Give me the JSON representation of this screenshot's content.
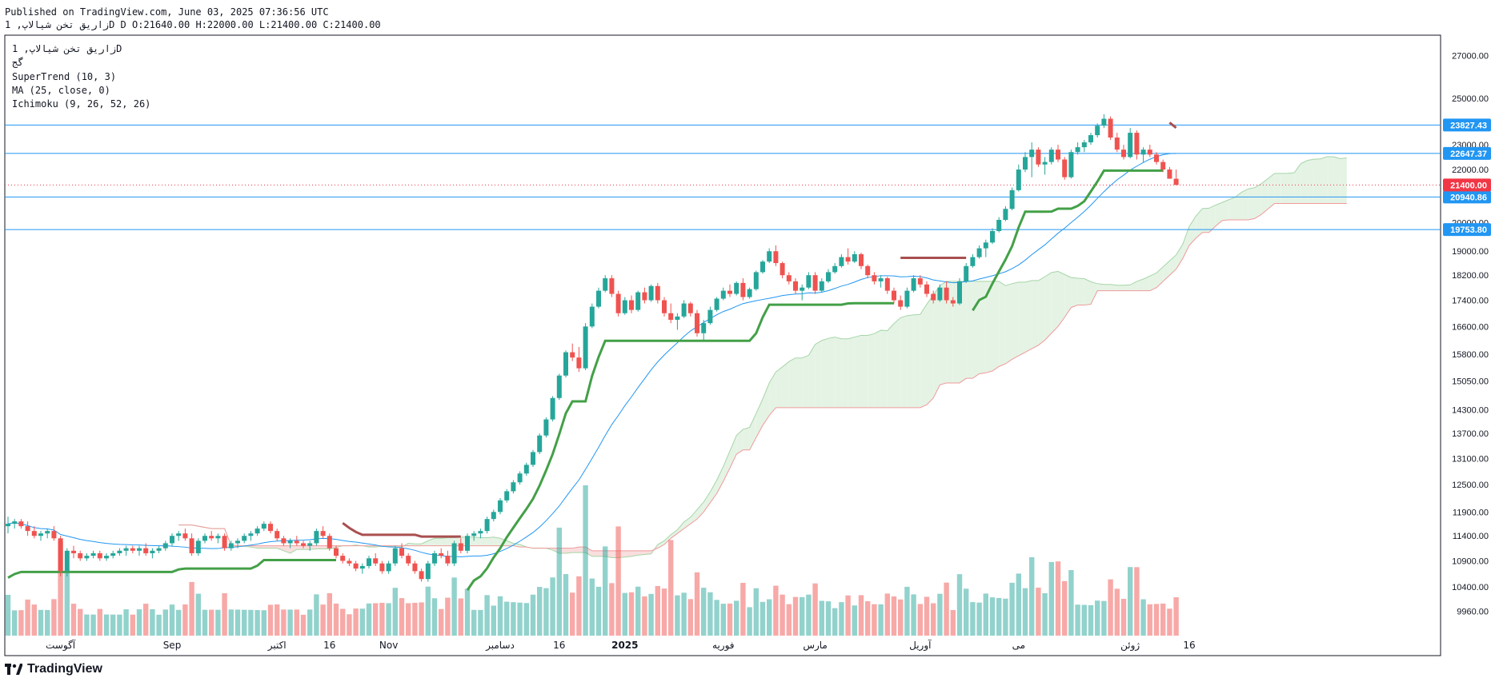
{
  "header": {
    "line1": "Published on TradingView.com, June 03, 2025 07:36:56 UTC",
    "symbol": "زاریق تخن شیالاپ, 1D",
    "ohlc": "D O:21640.00 H:22000.00 L:21400.00 C:21400.00"
  },
  "legend": {
    "title": "زاریق تخن شیالاپ, 1D",
    "line2": "گج",
    "supertrend": "SuperTrend (10, 3)",
    "ma": "MA (25, close, 0)",
    "ichimoku": "Ichimoku (9, 26, 52, 26)"
  },
  "brand": {
    "name": "TradingView"
  },
  "colors": {
    "up": "#26a69a",
    "down": "#ef5350",
    "supertrend_up": "#43a047",
    "supertrend_down": "#a94f4f",
    "ma": "#2196f3",
    "hline": "#2196f3",
    "cloud_green": "#e5f3e5",
    "cloud_red": "#f9dede",
    "price": "#f23645"
  },
  "chart_data": {
    "type": "candlestick",
    "interval": "1D",
    "y_axis": {
      "ticks": [
        27000,
        25000,
        23000,
        22000,
        20000,
        19000,
        18200,
        17400,
        16600,
        15800,
        15050,
        14300,
        13700,
        13100,
        12500,
        11900,
        11400,
        10900,
        10400,
        9960
      ],
      "tick_labels": [
        "27000.00",
        "25000.00",
        "23000.00",
        "22000.00",
        "20000.00",
        "19000.00",
        "18200.00",
        "17400.00",
        "16600.00",
        "15800.00",
        "15050.00",
        "14300.00",
        "13700.00",
        "13100.00",
        "12500.00",
        "11900.00",
        "11400.00",
        "10900.00",
        "10400.00",
        "9960.00"
      ],
      "scale": "log"
    },
    "x_axis": {
      "tick_labels": [
        "آگوست",
        "Sep",
        "اکتبر",
        "16",
        "Nov",
        "دسامبر",
        "16",
        "2025",
        "فوریه",
        "مارس",
        "آوریل",
        "می",
        "ژوئن",
        "16"
      ],
      "tick_bars": [
        8,
        25,
        41,
        49,
        58,
        75,
        84,
        94,
        109,
        123,
        139,
        154,
        171,
        180
      ]
    },
    "horizontal_lines": [
      {
        "value": 23827.43,
        "label": "23827.43"
      },
      {
        "value": 22647.37,
        "label": "22647.37"
      },
      {
        "value": 20940.86,
        "label": "20940.86"
      },
      {
        "value": 19753.8,
        "label": "19753.80"
      }
    ],
    "last_price": {
      "value": 21400.0,
      "label": "21400.00"
    },
    "ohlc": [
      [
        11600,
        11800,
        11450,
        11650
      ],
      [
        11650,
        11750,
        11550,
        11700
      ],
      [
        11700,
        11750,
        11550,
        11600
      ],
      [
        11600,
        11700,
        11400,
        11500
      ],
      [
        11500,
        11600,
        11350,
        11400
      ],
      [
        11400,
        11500,
        11300,
        11450
      ],
      [
        11450,
        11550,
        11350,
        11500
      ],
      [
        11500,
        11600,
        11300,
        11350
      ],
      [
        11350,
        11400,
        10600,
        10700
      ],
      [
        10700,
        11150,
        10600,
        11100
      ],
      [
        11100,
        11200,
        10950,
        11050
      ],
      [
        11050,
        11100,
        10900,
        10950
      ],
      [
        10950,
        11050,
        10900,
        11000
      ],
      [
        11000,
        11100,
        10950,
        11050
      ],
      [
        11050,
        11100,
        10900,
        10950
      ],
      [
        10950,
        11050,
        10900,
        11000
      ],
      [
        11000,
        11100,
        10950,
        11050
      ],
      [
        11050,
        11150,
        11000,
        11100
      ],
      [
        11100,
        11200,
        11000,
        11150
      ],
      [
        11150,
        11200,
        11050,
        11100
      ],
      [
        11100,
        11200,
        11000,
        11150
      ],
      [
        11150,
        11250,
        11000,
        11050
      ],
      [
        11050,
        11150,
        10950,
        11100
      ],
      [
        11100,
        11200,
        11050,
        11150
      ],
      [
        11150,
        11300,
        11100,
        11250
      ],
      [
        11250,
        11450,
        11200,
        11400
      ],
      [
        11400,
        11500,
        11300,
        11450
      ],
      [
        11450,
        11550,
        11300,
        11350
      ],
      [
        11350,
        11450,
        11000,
        11050
      ],
      [
        11050,
        11350,
        11000,
        11300
      ],
      [
        11300,
        11450,
        11250,
        11400
      ],
      [
        11400,
        11500,
        11300,
        11350
      ],
      [
        11350,
        11450,
        11250,
        11400
      ],
      [
        11400,
        11450,
        11100,
        11150
      ],
      [
        11150,
        11300,
        11100,
        11250
      ],
      [
        11250,
        11350,
        11150,
        11300
      ],
      [
        11300,
        11450,
        11250,
        11400
      ],
      [
        11400,
        11500,
        11300,
        11450
      ],
      [
        11450,
        11600,
        11400,
        11550
      ],
      [
        11550,
        11700,
        11500,
        11650
      ],
      [
        11650,
        11700,
        11450,
        11500
      ],
      [
        11500,
        11550,
        11300,
        11350
      ],
      [
        11350,
        11400,
        11200,
        11250
      ],
      [
        11250,
        11350,
        11150,
        11300
      ],
      [
        11300,
        11400,
        11200,
        11250
      ],
      [
        11250,
        11300,
        11150,
        11200
      ],
      [
        11200,
        11300,
        11100,
        11250
      ],
      [
        11250,
        11550,
        11200,
        11500
      ],
      [
        11500,
        11600,
        11350,
        11400
      ],
      [
        11400,
        11450,
        11100,
        11150
      ],
      [
        11150,
        11200,
        10950,
        11000
      ],
      [
        11000,
        11050,
        10850,
        10900
      ],
      [
        10900,
        10950,
        10800,
        10850
      ],
      [
        10850,
        10900,
        10700,
        10750
      ],
      [
        10750,
        10850,
        10650,
        10800
      ],
      [
        10800,
        11000,
        10750,
        10950
      ],
      [
        10950,
        11050,
        10800,
        10850
      ],
      [
        10850,
        10900,
        10650,
        10700
      ],
      [
        10700,
        10900,
        10650,
        10850
      ],
      [
        10850,
        11200,
        10800,
        11150
      ],
      [
        11150,
        11250,
        10950,
        11000
      ],
      [
        11000,
        11050,
        10800,
        10850
      ],
      [
        10850,
        10900,
        10650,
        10700
      ],
      [
        10700,
        10750,
        10500,
        10550
      ],
      [
        10550,
        10900,
        10500,
        10850
      ],
      [
        10850,
        11100,
        10800,
        11050
      ],
      [
        11050,
        11150,
        10950,
        11000
      ],
      [
        11000,
        11100,
        10800,
        10850
      ],
      [
        10850,
        11300,
        10800,
        11250
      ],
      [
        11250,
        11350,
        11050,
        11100
      ],
      [
        11100,
        11450,
        11050,
        11400
      ],
      [
        11400,
        11500,
        11300,
        11450
      ],
      [
        11450,
        11550,
        11350,
        11500
      ],
      [
        11500,
        11800,
        11450,
        11750
      ],
      [
        11750,
        11950,
        11700,
        11900
      ],
      [
        11900,
        12200,
        11850,
        12150
      ],
      [
        12150,
        12400,
        12100,
        12350
      ],
      [
        12350,
        12600,
        12300,
        12550
      ],
      [
        12550,
        12800,
        12500,
        12750
      ],
      [
        12750,
        13000,
        12700,
        12950
      ],
      [
        12950,
        13300,
        12900,
        13250
      ],
      [
        13250,
        13700,
        13200,
        13650
      ],
      [
        13650,
        14100,
        13600,
        14050
      ],
      [
        14050,
        14650,
        14000,
        14600
      ],
      [
        14600,
        15250,
        14550,
        15200
      ],
      [
        15200,
        15900,
        15150,
        15850
      ],
      [
        15850,
        16100,
        15600,
        15700
      ],
      [
        15700,
        16000,
        15300,
        15400
      ],
      [
        15400,
        16700,
        15350,
        16600
      ],
      [
        16600,
        17300,
        16550,
        17200
      ],
      [
        17200,
        17800,
        17150,
        17700
      ],
      [
        17700,
        18200,
        17650,
        18100
      ],
      [
        18100,
        18200,
        17500,
        17600
      ],
      [
        17600,
        17700,
        16900,
        17000
      ],
      [
        17000,
        17500,
        16950,
        17400
      ],
      [
        17400,
        17550,
        17000,
        17100
      ],
      [
        17100,
        17700,
        17050,
        17650
      ],
      [
        17650,
        17800,
        17300,
        17400
      ],
      [
        17400,
        17900,
        17350,
        17850
      ],
      [
        17850,
        17950,
        17300,
        17400
      ],
      [
        17400,
        17500,
        16900,
        17000
      ],
      [
        17000,
        17300,
        16700,
        16800
      ],
      [
        16800,
        17000,
        16500,
        16900
      ],
      [
        16900,
        17400,
        16850,
        17300
      ],
      [
        17300,
        17350,
        16900,
        17000
      ],
      [
        17000,
        17100,
        16300,
        16400
      ],
      [
        16400,
        16800,
        16200,
        16700
      ],
      [
        16700,
        17200,
        16650,
        17100
      ],
      [
        17100,
        17500,
        17050,
        17450
      ],
      [
        17450,
        17800,
        17400,
        17700
      ],
      [
        17700,
        17900,
        17500,
        17600
      ],
      [
        17600,
        18000,
        17550,
        17950
      ],
      [
        17950,
        18100,
        17400,
        17500
      ],
      [
        17500,
        17800,
        17450,
        17750
      ],
      [
        17750,
        18350,
        17700,
        18300
      ],
      [
        18300,
        18700,
        18250,
        18650
      ],
      [
        18650,
        19100,
        18600,
        19000
      ],
      [
        19000,
        19200,
        18500,
        18600
      ],
      [
        18600,
        18650,
        18100,
        18200
      ],
      [
        18200,
        18300,
        17900,
        18000
      ],
      [
        18000,
        18100,
        17600,
        17700
      ],
      [
        17700,
        17900,
        17400,
        17800
      ],
      [
        17800,
        18300,
        17750,
        18200
      ],
      [
        18200,
        18300,
        17600,
        17700
      ],
      [
        17700,
        18100,
        17650,
        18000
      ],
      [
        18000,
        18400,
        17950,
        18300
      ],
      [
        18300,
        18600,
        18250,
        18500
      ],
      [
        18500,
        18900,
        18450,
        18800
      ],
      [
        18800,
        19100,
        18550,
        18650
      ],
      [
        18650,
        19000,
        18600,
        18900
      ],
      [
        18900,
        18950,
        18400,
        18500
      ],
      [
        18500,
        18550,
        18100,
        18200
      ],
      [
        18200,
        18300,
        17900,
        18000
      ],
      [
        18000,
        18200,
        17800,
        18100
      ],
      [
        18100,
        18150,
        17600,
        17700
      ],
      [
        17700,
        17800,
        17300,
        17400
      ],
      [
        17400,
        17550,
        17100,
        17200
      ],
      [
        17200,
        17800,
        17150,
        17700
      ],
      [
        17700,
        18200,
        17650,
        18100
      ],
      [
        18100,
        18200,
        17800,
        17900
      ],
      [
        17900,
        18000,
        17500,
        17600
      ],
      [
        17600,
        17700,
        17300,
        17400
      ],
      [
        17400,
        17900,
        17350,
        17800
      ],
      [
        17800,
        18000,
        17300,
        17400
      ],
      [
        17400,
        17500,
        17200,
        17300
      ],
      [
        17300,
        18100,
        17250,
        18000
      ],
      [
        18000,
        18600,
        17950,
        18500
      ],
      [
        18500,
        18900,
        18450,
        18800
      ],
      [
        18800,
        19200,
        18750,
        19100
      ],
      [
        19100,
        19400,
        18800,
        19300
      ],
      [
        19300,
        19800,
        19250,
        19700
      ],
      [
        19700,
        20200,
        19650,
        20100
      ],
      [
        20100,
        20600,
        20050,
        20500
      ],
      [
        20500,
        21300,
        20450,
        21200
      ],
      [
        21200,
        22200,
        21150,
        22000
      ],
      [
        22000,
        22700,
        21900,
        22500
      ],
      [
        22500,
        23100,
        21700,
        22800
      ],
      [
        22800,
        22900,
        22100,
        22200
      ],
      [
        22200,
        22500,
        21800,
        22300
      ],
      [
        22300,
        22900,
        22200,
        22800
      ],
      [
        22800,
        23000,
        22300,
        22400
      ],
      [
        22400,
        22500,
        21600,
        21700
      ],
      [
        21700,
        22800,
        21650,
        22700
      ],
      [
        22700,
        23100,
        22600,
        22900
      ],
      [
        22900,
        23200,
        22700,
        23100
      ],
      [
        23100,
        23500,
        23000,
        23400
      ],
      [
        23400,
        23900,
        23300,
        23800
      ],
      [
        23800,
        24300,
        23700,
        24100
      ],
      [
        24100,
        24200,
        23200,
        23300
      ],
      [
        23300,
        23500,
        22700,
        22800
      ],
      [
        22800,
        23000,
        22400,
        22500
      ],
      [
        22500,
        23700,
        22450,
        23500
      ],
      [
        23500,
        23600,
        22400,
        22600
      ],
      [
        22600,
        22900,
        22300,
        22800
      ],
      [
        22800,
        23000,
        22500,
        22600
      ],
      [
        22600,
        22700,
        22200,
        22300
      ],
      [
        22300,
        22400,
        21900,
        22000
      ],
      [
        22000,
        22100,
        21700,
        21640
      ],
      [
        21640,
        22000,
        21400,
        21400
      ]
    ],
    "volume_note": "volume histogram shown at bottom, colored by candle direction"
  }
}
